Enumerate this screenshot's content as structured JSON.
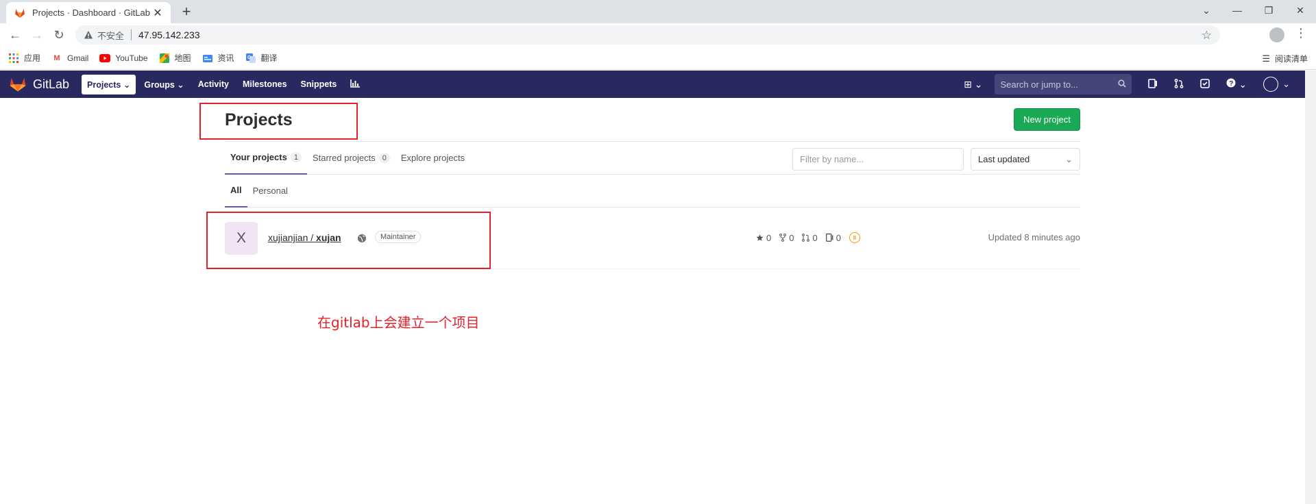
{
  "browser": {
    "tab_title": "Projects · Dashboard · GitLab",
    "insecure_label": "不安全",
    "url": "47.95.142.233",
    "bookmarks": [
      {
        "label": "应用",
        "icon": "apps-grid-icon"
      },
      {
        "label": "Gmail",
        "icon": "gmail-icon"
      },
      {
        "label": "YouTube",
        "icon": "youtube-icon"
      },
      {
        "label": "地图",
        "icon": "maps-icon"
      },
      {
        "label": "资讯",
        "icon": "news-icon"
      },
      {
        "label": "翻译",
        "icon": "translate-icon"
      }
    ],
    "reading_list": "阅读清单"
  },
  "gitlab_nav": {
    "brand": "GitLab",
    "links": [
      "Projects",
      "Groups",
      "Activity",
      "Milestones",
      "Snippets"
    ],
    "search_placeholder": "Search or jump to..."
  },
  "page": {
    "title": "Projects",
    "new_project_button": "New project",
    "tabs": [
      {
        "label": "Your projects",
        "count": "1"
      },
      {
        "label": "Starred projects",
        "count": "0"
      },
      {
        "label": "Explore projects"
      }
    ],
    "filter_placeholder": "Filter by name...",
    "sort_value": "Last updated",
    "subtabs": [
      "All",
      "Personal"
    ]
  },
  "project": {
    "avatar_letter": "X",
    "namespace": "xujianjian / ",
    "name": "xujan",
    "role": "Maintainer",
    "stars": "0",
    "forks": "0",
    "merge_requests": "0",
    "issues": "0",
    "updated": "Updated 8 minutes ago"
  },
  "annotation": {
    "note": "在gitlab上会建立一个项目",
    "color": "#e8202a"
  }
}
